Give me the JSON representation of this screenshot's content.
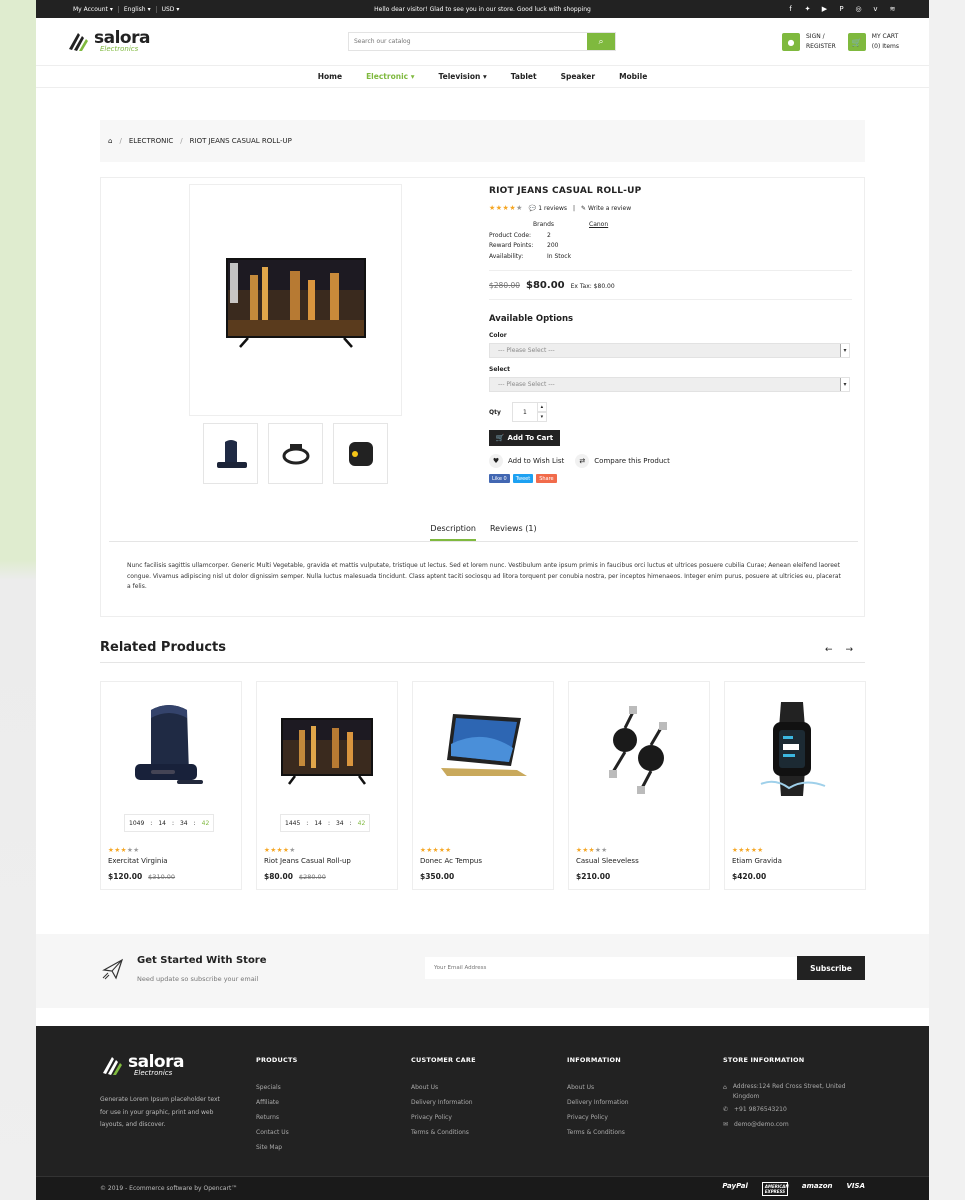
{
  "topbar": {
    "account": "My Account",
    "language": "English",
    "currency": "USD",
    "message": "Hello dear visitor! Glad to see you in our store. Good luck with shopping",
    "social_icons": [
      "facebook-icon",
      "twitter-icon",
      "youtube-icon",
      "pinterest-icon",
      "instagram-icon",
      "vimeo-icon",
      "rss-icon"
    ]
  },
  "header": {
    "logo_main": "salora",
    "logo_sub": "Electronics",
    "search_placeholder": "Search our catalog",
    "sign_line1": "SIGN /",
    "sign_line2": "REGISTER",
    "cart_line1": "MY CART",
    "cart_line2": "(0) Items"
  },
  "nav": {
    "items": [
      "Home",
      "Electronic",
      "Television",
      "Tablet",
      "Speaker",
      "Mobile"
    ],
    "active": "Electronic",
    "accent": "#7fb93e"
  },
  "breadcrumb": [
    "ELECTRONIC",
    "RIOT JEANS CASUAL ROLL-UP"
  ],
  "product": {
    "title": "RIOT JEANS CASUAL ROLL-UP",
    "rating": 4,
    "reviews_link": "1 reviews",
    "write_review": "Write a review",
    "brand_label": "Brands",
    "brand_value": "Canon",
    "code_label": "Product Code:",
    "code_value": "2",
    "reward_label": "Reward Points:",
    "reward_value": "200",
    "avail_label": "Availability:",
    "avail_value": "In Stock",
    "old_price": "$280.00",
    "price": "$80.00",
    "ex_tax": "Ex Tax: $80.00",
    "options_title": "Available Options",
    "color_label": "Color",
    "color_placeholder": "--- Please Select ---",
    "select_label": "Select",
    "select_placeholder": "--- Please Select ---",
    "qty_label": "Qty",
    "qty_value": "1",
    "add_to_cart": "Add To Cart",
    "wishlist": "Add to Wish List",
    "compare": "Compare this Product",
    "share_like": "Like 0",
    "share_tweet": "Tweet",
    "share_share": "Share"
  },
  "tabs": {
    "description": "Description",
    "reviews": "Reviews (1)"
  },
  "description": "Nunc facilisis sagittis ullamcorper. Generic Multi Vegetable, gravida et mattis vulputate, tristique ut lectus. Sed et lorem nunc. Vestibulum ante ipsum primis in faucibus orci luctus et ultrices posuere cubilia Curae; Aenean eleifend laoreet congue. Vivamus adipiscing nisl ut dolor dignissim semper. Nulla luctus malesuada tincidunt. Class aptent taciti sociosqu ad litora torquent per conubia nostra, per inceptos himenaeos. Integer enim purus, posuere at ultricies eu, placerat a felis.",
  "related": {
    "title": "Related Products",
    "items": [
      {
        "name": "Exercitat Virginia",
        "price": "$120.00",
        "old_price": "$310.00",
        "rating": 3,
        "timer": [
          "1049",
          "14",
          "34",
          "42"
        ],
        "icon": "speaker-icon"
      },
      {
        "name": "Riot Jeans Casual Roll-up",
        "price": "$80.00",
        "old_price": "$280.00",
        "rating": 4,
        "timer": [
          "1445",
          "14",
          "34",
          "42"
        ],
        "icon": "tv-icon"
      },
      {
        "name": "Donec Ac Tempus",
        "price": "$350.00",
        "old_price": "",
        "rating": 5,
        "timer": [],
        "icon": "laptop-icon"
      },
      {
        "name": "Casual Sleeveless",
        "price": "$210.00",
        "old_price": "",
        "rating": 3,
        "timer": [],
        "icon": "cable-icon"
      },
      {
        "name": "Etiam Gravida",
        "price": "$420.00",
        "old_price": "",
        "rating": 5,
        "timer": [],
        "icon": "smartwatch-icon"
      }
    ]
  },
  "newsletter": {
    "title": "Get Started With Store",
    "subtitle": "Need update so subscribe your email",
    "placeholder": "Your Email Address",
    "button": "Subscribe"
  },
  "footer": {
    "about": "Generate Lorem Ipsum placeholder text for use in your graphic, print and web layouts, and discover.",
    "products_title": "PRODUCTS",
    "products": [
      "Specials",
      "Affiliate",
      "Returns",
      "Contact Us",
      "Site Map"
    ],
    "care_title": "CUSTOMER CARE",
    "care": [
      "About Us",
      "Delivery Information",
      "Privacy Policy",
      "Terms & Conditions"
    ],
    "info_title": "INFORMATION",
    "info": [
      "About Us",
      "Delivery Information",
      "Privacy Policy",
      "Terms & Conditions"
    ],
    "store_title": "STORE INFORMATION",
    "address": "Address:124 Red Cross Street, United Kingdom",
    "phone": "+91 9876543210",
    "email": "demo@demo.com",
    "copyright": "© 2019 - Ecommerce software by Opencart™",
    "payments": [
      "PayPal",
      "AMERICAN EXPRESS",
      "amazon",
      "VISA"
    ]
  }
}
